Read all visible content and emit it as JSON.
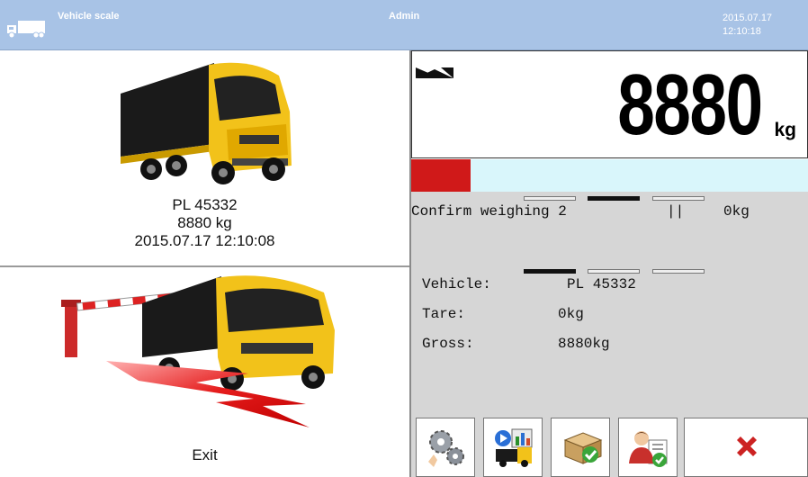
{
  "header": {
    "title": "Vehicle scale",
    "user": "Admin",
    "date": "2015.07.17",
    "time": "12:10:18"
  },
  "vehicle_card": {
    "plate": "PL 45332",
    "weight": "8880 kg",
    "timestamp": "2015.07.17 12:10:08"
  },
  "exit_panel": {
    "label": "Exit"
  },
  "display": {
    "weight": "8880",
    "unit": "kg",
    "bar_fill_fraction": 0.15
  },
  "status": {
    "confirm": "Confirm weighing 2",
    "pipes": "||",
    "zero": "0kg"
  },
  "details": {
    "vehicle_label": "Vehicle:",
    "vehicle_value": "PL 45332",
    "tare_label": "Tare:",
    "tare_value": "0kg",
    "gross_label": "Gross:",
    "gross_value": "8880kg"
  },
  "toolbar": {
    "icons": [
      "settings-gears-icon",
      "vehicle-database-icon",
      "product-database-icon",
      "user-documents-icon",
      "cancel-icon"
    ]
  },
  "colors": {
    "header": "#a8c3e6",
    "bar_fill": "#d01919",
    "bar_bg": "#d9f6fb",
    "panel_gray": "#d6d6d6",
    "cancel": "#cc2222"
  }
}
